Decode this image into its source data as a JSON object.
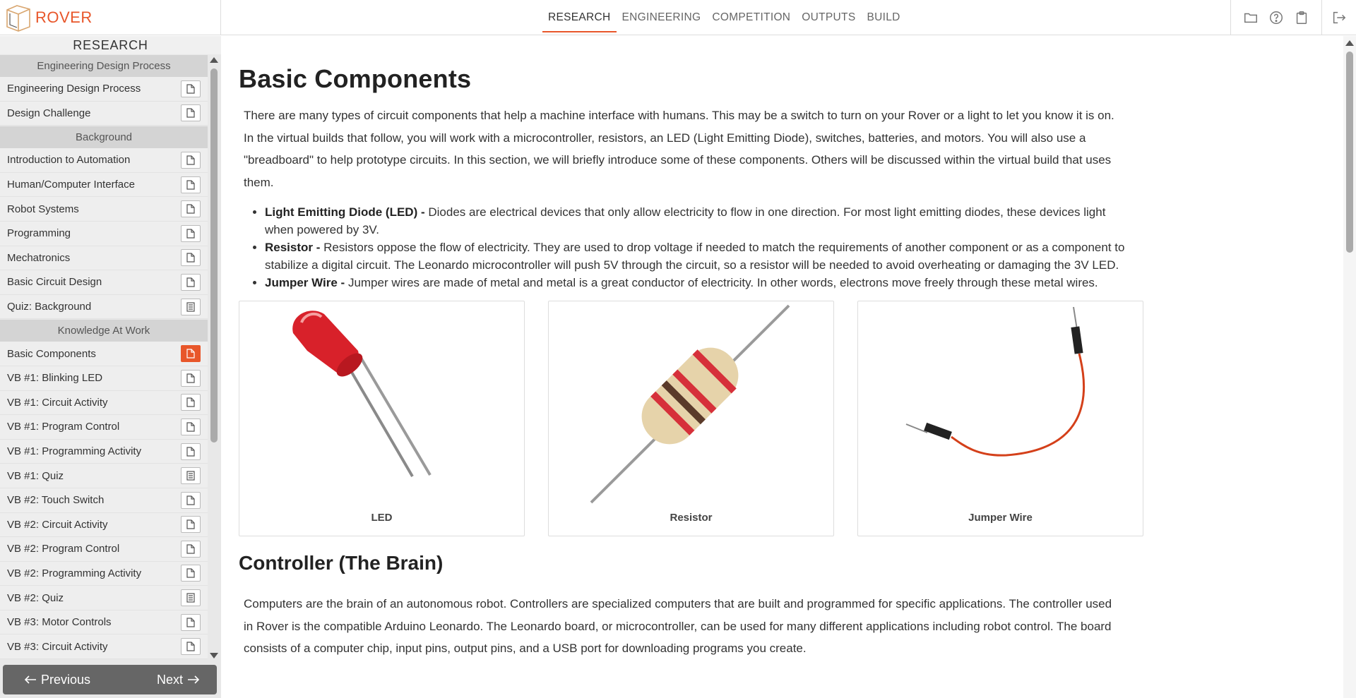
{
  "brand": {
    "name": "ROVER"
  },
  "nav": [
    {
      "label": "RESEARCH",
      "active": true
    },
    {
      "label": "ENGINEERING"
    },
    {
      "label": "COMPETITION"
    },
    {
      "label": "OUTPUTS"
    },
    {
      "label": "BUILD"
    }
  ],
  "tools": {
    "icons": [
      "folder-icon",
      "help-icon",
      "clipboard-icon",
      "logout-icon"
    ]
  },
  "sidebar": {
    "heading": "RESEARCH",
    "groups": [
      {
        "title": "Engineering Design Process",
        "items": [
          {
            "label": "Engineering Design Process",
            "icon": "document-icon"
          },
          {
            "label": "Design Challenge",
            "icon": "document-icon"
          }
        ]
      },
      {
        "title": "Background",
        "items": [
          {
            "label": "Introduction to Automation",
            "icon": "document-icon"
          },
          {
            "label": "Human/Computer Interface",
            "icon": "document-icon"
          },
          {
            "label": "Robot Systems",
            "icon": "document-icon"
          },
          {
            "label": "Programming",
            "icon": "document-icon"
          },
          {
            "label": "Mechatronics",
            "icon": "document-icon"
          },
          {
            "label": "Basic Circuit Design",
            "icon": "document-icon"
          },
          {
            "label": "Quiz: Background",
            "icon": "quiz-icon"
          }
        ]
      },
      {
        "title": "Knowledge At Work",
        "items": [
          {
            "label": "Basic Components",
            "icon": "document-icon",
            "active": true
          },
          {
            "label": "VB #1: Blinking LED",
            "icon": "document-icon"
          },
          {
            "label": "VB #1: Circuit Activity",
            "icon": "document-icon"
          },
          {
            "label": "VB #1: Program Control",
            "icon": "document-icon"
          },
          {
            "label": "VB #1: Programming Activity",
            "icon": "document-icon"
          },
          {
            "label": "VB #1: Quiz",
            "icon": "quiz-icon"
          },
          {
            "label": "VB #2: Touch Switch",
            "icon": "document-icon"
          },
          {
            "label": "VB #2: Circuit Activity",
            "icon": "document-icon"
          },
          {
            "label": "VB #2: Program Control",
            "icon": "document-icon"
          },
          {
            "label": "VB #2: Programming Activity",
            "icon": "document-icon"
          },
          {
            "label": "VB #2: Quiz",
            "icon": "quiz-icon"
          },
          {
            "label": "VB #3: Motor Controls",
            "icon": "document-icon"
          },
          {
            "label": "VB #3: Circuit Activity",
            "icon": "document-icon"
          }
        ]
      }
    ],
    "pager": {
      "previous": "Previous",
      "next": "Next"
    }
  },
  "main": {
    "title": "Basic Components",
    "intro": "There are many types of circuit components that help a machine interface with humans. This may be a switch to turn on your Rover or a light to let you know it is on. In the virtual builds that follow, you will work with a microcontroller, resistors, an LED (Light Emitting Diode), switches, batteries, and motors. You will also use a \"breadboard\" to help prototype circuits. In this section, we will briefly introduce some of these components. Others will be discussed within the virtual build that uses them.",
    "bullets": [
      {
        "term": "Light Emitting Diode (LED) -",
        "text": " Diodes are electrical devices that only allow electricity to flow in one direction. For most light emitting diodes, these devices light when powered by 3V."
      },
      {
        "term": "Resistor -",
        "text": " Resistors oppose the flow of electricity. They are used to drop voltage if needed to match the requirements of another component or as a component to stabilize a digital circuit. The Leonardo microcontroller will push 5V through the circuit, so a resistor will be needed to avoid overheating or damaging the 3V LED."
      },
      {
        "term": "Jumper Wire -",
        "text": " Jumper wires are made of metal and metal is a great conductor of electricity. In other words, electrons move freely through these metal wires."
      }
    ],
    "cards": [
      {
        "caption": "LED",
        "image": "led-image"
      },
      {
        "caption": "Resistor",
        "image": "resistor-image"
      },
      {
        "caption": "Jumper Wire",
        "image": "jumper-wire-image"
      }
    ],
    "section2_title": "Controller (The Brain)",
    "section2_text": "Computers are the brain of an autonomous robot. Controllers are specialized computers that are built and programmed for specific applications. The controller used in Rover is the compatible Arduino Leonardo. The Leonardo board, or microcontroller, can be used for many different applications including robot control. The board consists of a computer chip, input pins, output pins, and a USB port for downloading programs you create."
  },
  "colors": {
    "accent": "#e8562a",
    "sidebar_bg": "#e8e8e8",
    "section_bg": "#d4d4d4"
  }
}
